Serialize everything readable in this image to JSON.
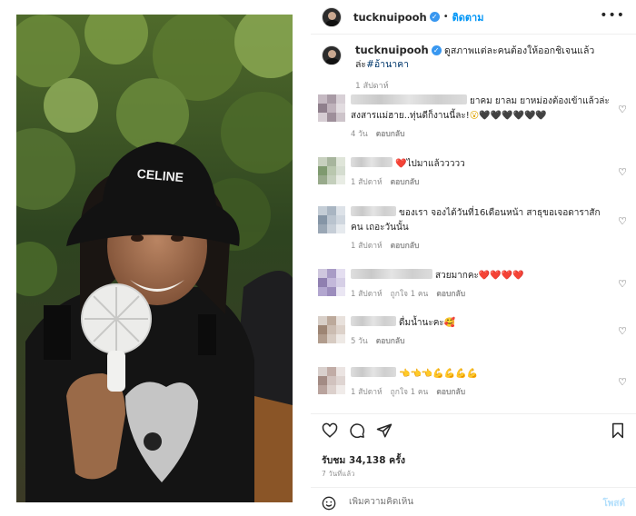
{
  "post": {
    "username": "tucknuipooh",
    "follow_label": "ติดตาม",
    "more_label": "•••",
    "caption": {
      "text": "ดูสภาพแต่ละคนต้องให้ออกชิเจนแล้วล่ะ",
      "hashtag": "#อ้านาคา",
      "time": "1 สัปดาห์"
    }
  },
  "media": {
    "hat_text": "CELINE"
  },
  "comments": [
    {
      "text": "ยาคม ยาลม ยาหม่องต้องเข้าแล้วล่ะ สงสารแม่ฮาย..ทุ่นดีก็งานนี้ละ!",
      "emojis": "😮",
      "hearts": "🖤🖤🖤🖤🖤🖤",
      "time": "4 วัน",
      "reply": "ตอบกลับ",
      "likes": ""
    },
    {
      "text": "ไปมาแล้ววววว",
      "emojis": "❤️",
      "hearts": "",
      "time": "1 สัปดาห์",
      "reply": "ตอบกลับ",
      "likes": ""
    },
    {
      "text": "ของเรา จองได้วันที่16เดือนหน้า สาธุขอเจอดาราสักคน เถอะวันนั้น",
      "emojis": "",
      "hearts": "",
      "time": "1 สัปดาห์",
      "reply": "ตอบกลับ",
      "likes": ""
    },
    {
      "text": "สวยมากคะ",
      "emojis": "",
      "hearts": "❤️❤️❤️❤️",
      "time": "1 สัปดาห์",
      "reply": "ตอบกลับ",
      "likes": "ถูกใจ 1 คน"
    },
    {
      "text": "ดื่มน้ำนะคะ",
      "emojis": "💛",
      "hearts": "🥰",
      "time": "5 วัน",
      "reply": "ตอบกลับ",
      "likes": ""
    },
    {
      "text": "",
      "emojis": "👈👈👈💪💪💪💪",
      "hearts": "",
      "time": "1 สัปดาห์",
      "reply": "ตอบกลับ",
      "likes": "ถูกใจ 1 คน"
    }
  ],
  "actions": {
    "views": "รับชม 34,138 ครั้ง",
    "posted": "7 วันที่แล้ว",
    "add_comment_placeholder": "เพิ่มความคิดเห็น",
    "post_label": "โพสต์"
  },
  "icons": [
    "heart-icon",
    "comment-icon",
    "share-icon",
    "bookmark-icon",
    "emoji-icon",
    "verified-icon"
  ],
  "colors": {
    "link_blue": "#0095f6",
    "verified_blue": "#3897f0",
    "muted": "#8e8e8e",
    "heart_red": "#ed4956"
  }
}
